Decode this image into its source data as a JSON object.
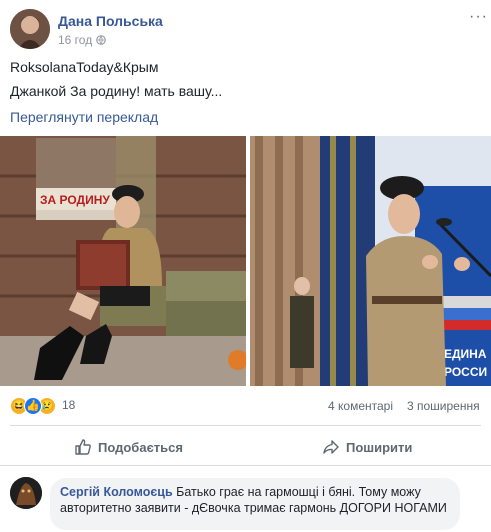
{
  "post": {
    "author": "Дана Польська",
    "time": "16 год",
    "text_line1": "RoksolanaToday&Крым",
    "text_line2": "Джанкой За родину! мать вашу...",
    "see_translation": "Переглянути переклад"
  },
  "photos": {
    "poster_text": "ЗА РОДИНУ",
    "banner_text_1": "ЕДИНА",
    "banner_text_2": "РОССИ"
  },
  "stats": {
    "reaction_count": "18",
    "comments": "4 коментарі",
    "shares": "3 поширення"
  },
  "actions": {
    "like": "Подобається",
    "share": "Поширити"
  },
  "comment": {
    "author": "Сергій Коломоєць",
    "text": "Батько грає на гармошці і бяні. Тому можу авторитетно заявити - дЄвочка тримає гармонь ДОГОРИ НОГАМИ"
  },
  "colors": {
    "link": "#385898",
    "secondary": "#90949c",
    "bubble": "#f2f3f5"
  }
}
